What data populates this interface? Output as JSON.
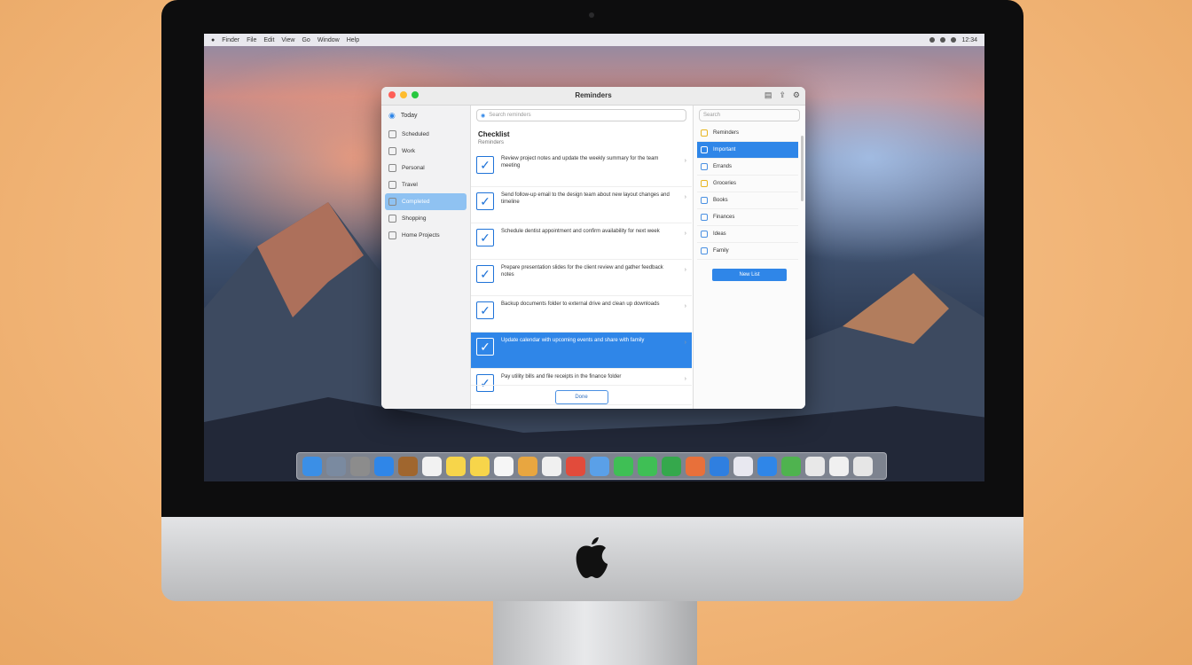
{
  "menubar": {
    "items": [
      "Finder",
      "File",
      "Edit",
      "View",
      "Go",
      "Window",
      "Help"
    ],
    "status": [
      "12:34"
    ]
  },
  "window": {
    "title": "Reminders",
    "sidebar": {
      "header": "Today",
      "items": [
        {
          "label": "Scheduled",
          "active": false
        },
        {
          "label": "Work",
          "active": false
        },
        {
          "label": "Personal",
          "active": false
        },
        {
          "label": "Travel",
          "active": false
        },
        {
          "label": "Completed",
          "active": true
        },
        {
          "label": "Shopping",
          "active": false
        },
        {
          "label": "Home Projects",
          "active": false
        }
      ]
    },
    "center": {
      "search_placeholder": "Search reminders",
      "title": "Checklist",
      "subtitle": "Reminders",
      "tasks": [
        {
          "text": "Review project notes and update the weekly summary for the team meeting",
          "selected": false
        },
        {
          "text": "Send follow-up email to the design team about new layout changes and timeline",
          "selected": false
        },
        {
          "text": "Schedule dentist appointment and confirm availability for next week",
          "selected": false
        },
        {
          "text": "Prepare presentation slides for the client review and gather feedback notes",
          "selected": false
        },
        {
          "text": "Backup documents folder to external drive and clean up downloads",
          "selected": false
        },
        {
          "text": "Update calendar with upcoming events and share with family",
          "selected": true
        },
        {
          "text": "Pay utility bills and file receipts in the finance folder",
          "selected": false
        }
      ],
      "done_label": "Done"
    },
    "right": {
      "search_placeholder": "Search",
      "items": [
        {
          "label": "Reminders",
          "active": false,
          "color": "#e8b520"
        },
        {
          "label": "Important",
          "active": true,
          "color": "#2f86e8"
        },
        {
          "label": "Errands",
          "active": false,
          "color": "#4a90e2"
        },
        {
          "label": "Groceries",
          "active": false,
          "color": "#e8b520"
        },
        {
          "label": "Books",
          "active": false,
          "color": "#4a90e2"
        },
        {
          "label": "Finances",
          "active": false,
          "color": "#4a90e2"
        },
        {
          "label": "Ideas",
          "active": false,
          "color": "#4a90e2"
        },
        {
          "label": "Family",
          "active": false,
          "color": "#4a90e2"
        }
      ],
      "button_label": "New List"
    }
  },
  "dock": {
    "icons": [
      {
        "name": "finder-icon",
        "color": "#3b8fe6"
      },
      {
        "name": "launchpad-icon",
        "color": "#7a8aa0"
      },
      {
        "name": "system-preferences-icon",
        "color": "#8c8c8c"
      },
      {
        "name": "safari-icon",
        "color": "#2f86e8"
      },
      {
        "name": "contacts-icon",
        "color": "#a0662e"
      },
      {
        "name": "calendar-icon",
        "color": "#f2f2f2"
      },
      {
        "name": "notes-icon",
        "color": "#f7d54a"
      },
      {
        "name": "stickies-icon",
        "color": "#f7d54a"
      },
      {
        "name": "reminders-icon",
        "color": "#f6f6f6"
      },
      {
        "name": "maps-icon",
        "color": "#e8a640"
      },
      {
        "name": "photos-icon",
        "color": "#f0f0f0"
      },
      {
        "name": "photo-booth-icon",
        "color": "#e24b3b"
      },
      {
        "name": "preview-icon",
        "color": "#5aa0e8"
      },
      {
        "name": "facetime-icon",
        "color": "#3fbf55"
      },
      {
        "name": "messages-icon",
        "color": "#3fbf55"
      },
      {
        "name": "facetime-video-icon",
        "color": "#35a84c"
      },
      {
        "name": "itunes-icon",
        "color": "#e8703a"
      },
      {
        "name": "app-store-icon",
        "color": "#2f7fe0"
      },
      {
        "name": "ibooks-icon",
        "color": "#e8e8f0"
      },
      {
        "name": "keynote-icon",
        "color": "#2f86e8"
      },
      {
        "name": "numbers-icon",
        "color": "#4fb34f"
      },
      {
        "name": "pages-icon",
        "color": "#e8e8e8"
      },
      {
        "name": "downloads-folder-icon",
        "color": "#f0f0f0"
      },
      {
        "name": "trash-icon",
        "color": "#e6e6e6"
      }
    ]
  }
}
